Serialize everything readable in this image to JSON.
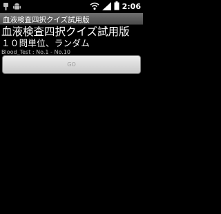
{
  "status_bar": {
    "icons": [
      "usb-icon",
      "android-debug-icon",
      "wifi-icon",
      "signal-icon",
      "battery-icon"
    ],
    "time": "2:06"
  },
  "app": {
    "window_title": "血液検査四択クイズ試用版"
  },
  "main": {
    "title": "血液検査四択クイズ試用版",
    "subtitle": "１０問単位、ランダム",
    "range_label": "Blood_Test : No.1 - No.10",
    "go_button_label": "GO"
  },
  "colors": {
    "background": "#000000",
    "title_bar": "#5a5a5a",
    "button": "#dcdcdc",
    "button_text": "#9c9c9c"
  }
}
